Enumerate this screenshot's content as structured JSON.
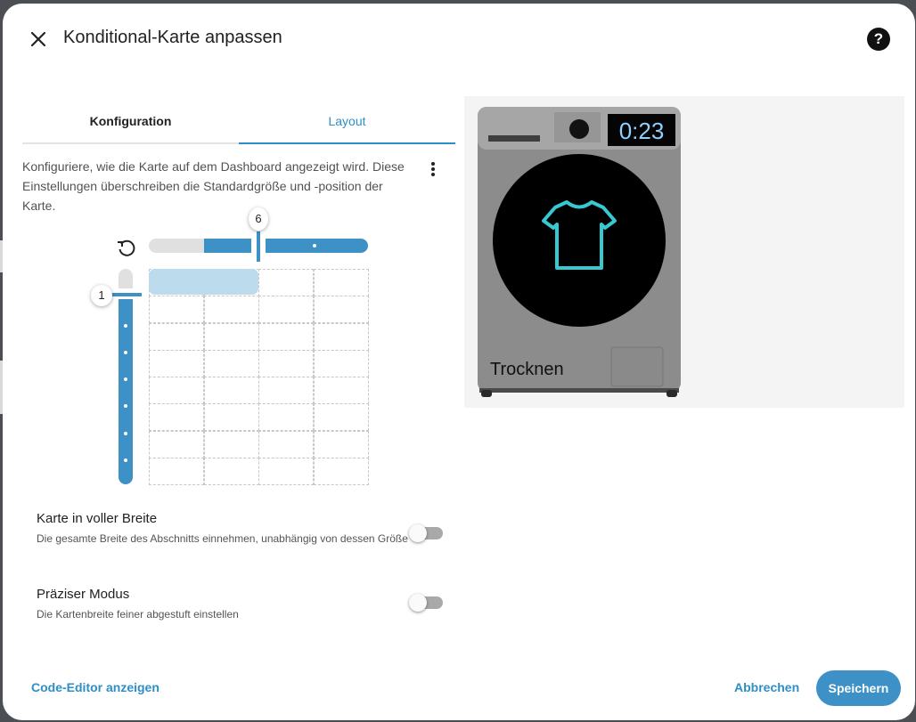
{
  "dialog": {
    "title": "Konditional-Karte anpassen",
    "close_icon": "close-icon",
    "help_icon": "help-circle-icon",
    "help_glyph": "?"
  },
  "tabs": [
    {
      "label": "Konfiguration",
      "active": false
    },
    {
      "label": "Layout",
      "active": true
    }
  ],
  "layout": {
    "description": "Konfiguriere, wie die Karte auf dem Dashboard angezeigt wird. Diese Einstellungen überschreiben die Standardgröße und -position der Karte.",
    "more_icon": "dots-vertical-icon",
    "reset_icon": "restore-icon",
    "columns_value": "6",
    "rows_value": "1",
    "grid": {
      "columns": 4,
      "rows": 8,
      "selected_columns": 2,
      "selected_rows": 1
    }
  },
  "options": [
    {
      "title": "Karte in voller Breite",
      "subtitle": "Die gesamte Breite des Abschnitts einnehmen, unabhängig von dessen Größe",
      "checked": false
    },
    {
      "title": "Präziser Modus",
      "subtitle": "Die Kartenbreite feiner abgestuft einstellen",
      "checked": false
    }
  ],
  "preview": {
    "timer": "0:23",
    "status": "Trocknen",
    "icon": "shirt-icon",
    "colors": {
      "body": "#8c8c8c",
      "drum": "#000000",
      "shirt": "#37c8d2",
      "timer_text": "#8ed0ff"
    }
  },
  "footer": {
    "code_editor": "Code-Editor anzeigen",
    "cancel": "Abbrechen",
    "save": "Speichern"
  },
  "colors": {
    "accent": "#3d91c6",
    "link": "#2d8fc8"
  }
}
